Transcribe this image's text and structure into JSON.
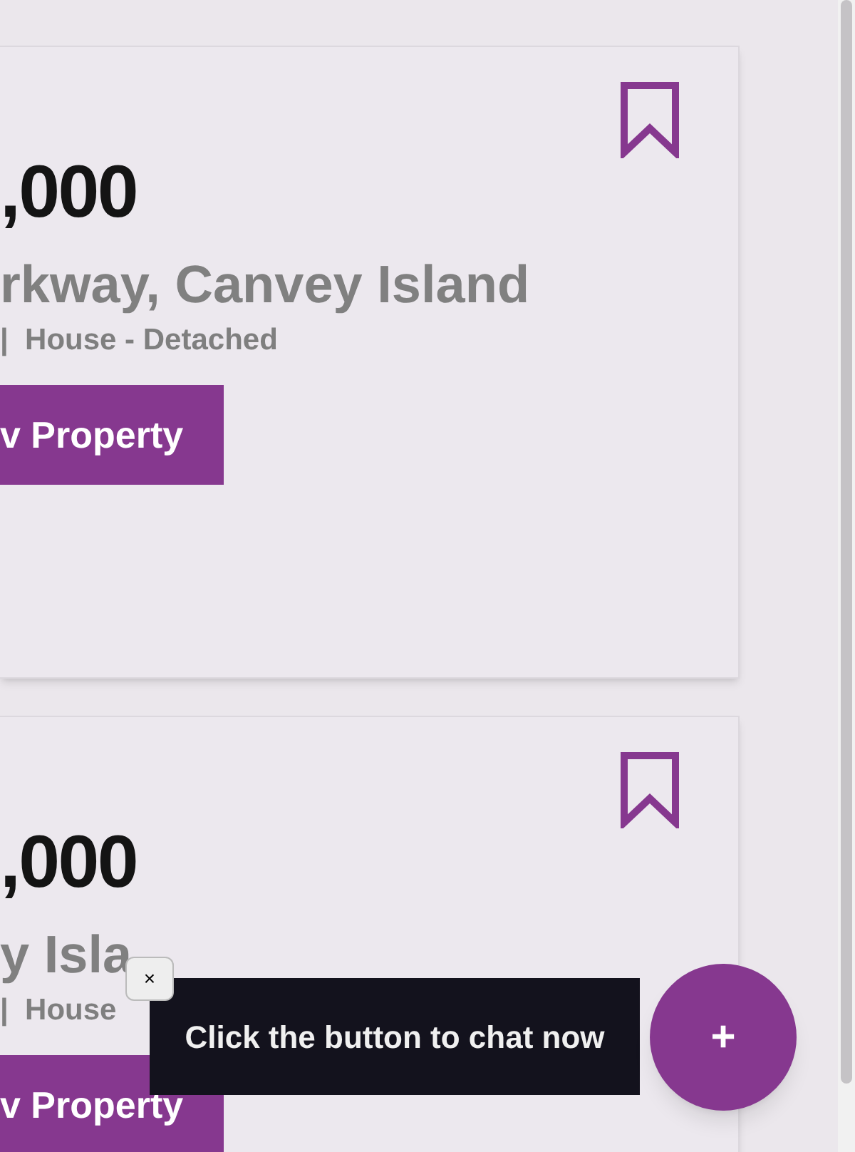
{
  "listings": [
    {
      "price": ",000",
      "address": "rkway, Canvey Island",
      "details": "|  House - Detached",
      "button": "v Property"
    },
    {
      "price": ",000",
      "address": "y Isla",
      "details": "|  House",
      "button": "v Property"
    }
  ],
  "chat_prompt": {
    "close": "×",
    "message": "Click the button to chat now"
  },
  "chat_button": {
    "label": "+"
  }
}
